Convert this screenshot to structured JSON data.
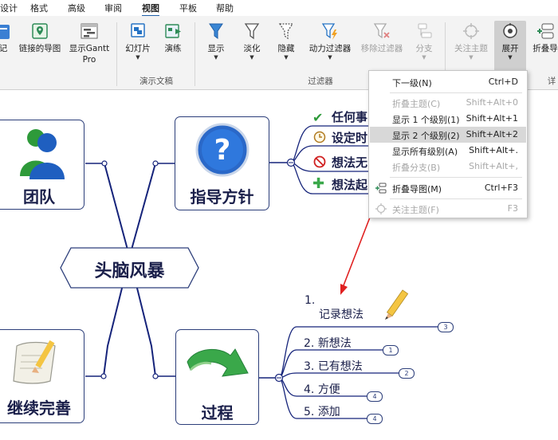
{
  "menu": {
    "tabs": [
      "设计",
      "格式",
      "高级",
      "审阅",
      "视图",
      "平板",
      "帮助"
    ],
    "active_tab": "视图"
  },
  "ribbon": {
    "buttons": {
      "note": "记",
      "linked_map": "链接的导图",
      "gantt_line1": "显示Gantt",
      "gantt_line2": "Pro",
      "slideshow": "幻灯片",
      "rehearse": "演练",
      "show": "显示",
      "fade": "淡化",
      "hide": "隐藏",
      "dynamic_filter": "动力过滤器",
      "remove_filter": "移除过滤器",
      "branch": "分支",
      "focus_topic": "关注主题",
      "expand": "展开",
      "collapse": "折叠导"
    },
    "groups": {
      "presentation": "演示文稿",
      "filter": "过滤器",
      "details": "详"
    }
  },
  "dropdown": {
    "items": [
      {
        "label": "下一级(N)",
        "shortcut": "Ctrl+D",
        "disabled": false
      },
      {
        "label": "折叠主题(C)",
        "shortcut": "Shift+Alt+0",
        "disabled": true
      },
      {
        "label": "显示 1 个级别(1)",
        "shortcut": "Shift+Alt+1",
        "disabled": false
      },
      {
        "label": "显示 2 个级别(2)",
        "shortcut": "Shift+Alt+2",
        "disabled": false,
        "highlighted": true
      },
      {
        "label": "显示所有级别(A)",
        "shortcut": "Shift+Alt+.",
        "disabled": false
      },
      {
        "label": "折叠分支(B)",
        "shortcut": "Shift+Alt+,",
        "disabled": true
      },
      {
        "label": "折叠导图(M)",
        "shortcut": "Ctrl+F3",
        "disabled": false
      },
      {
        "label": "关注主题(F)",
        "shortcut": "F3",
        "disabled": true
      }
    ]
  },
  "map": {
    "central": "头脑风暴",
    "team": "团队",
    "guide": "指导方针",
    "continue": "继续完善",
    "process": "过程",
    "guide_subtopics": [
      "任何事",
      "设定时",
      "想法无",
      "想法起"
    ],
    "process_steps": [
      {
        "num": "1.",
        "text": "记录想法",
        "badge": "3"
      },
      {
        "num": "2.",
        "text": "新想法",
        "badge": "1"
      },
      {
        "num": "3.",
        "text": "已有想法",
        "badge": "2"
      },
      {
        "num": "4.",
        "text": "方便",
        "badge": "4"
      },
      {
        "num": "5.",
        "text": "添加",
        "badge": "4"
      }
    ]
  },
  "colors": {
    "branch_line": "#15237a",
    "arrow": "#e02020",
    "node_border": "#2c3e7a",
    "text": "#1a1f4a"
  }
}
